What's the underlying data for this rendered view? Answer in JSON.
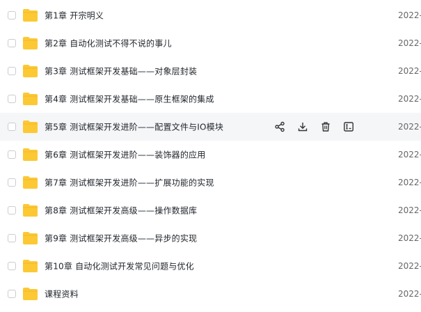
{
  "files": [
    {
      "name": "第1章 开宗明义",
      "date": "2022-"
    },
    {
      "name": "第2章 自动化测试不得不说的事儿",
      "date": "2022-"
    },
    {
      "name": "第3章 测试框架开发基础——对象层封装",
      "date": "2022-"
    },
    {
      "name": "第4章 测试框架开发基础——原生框架的集成",
      "date": "2022-"
    },
    {
      "name": "第5章 测试框架开发进阶——配置文件与IO模块",
      "date": "2022-"
    },
    {
      "name": "第6章 测试框架开发进阶——装饰器的应用",
      "date": "2022-"
    },
    {
      "name": "第7章 测试框架开发进阶——扩展功能的实现",
      "date": "2022-"
    },
    {
      "name": "第8章 测试框架开发高级——操作数据库",
      "date": "2022-"
    },
    {
      "name": "第9章 测试框架开发高级——异步的实现",
      "date": "2022-"
    },
    {
      "name": "第10章 自动化测试开发常见问题与优化",
      "date": "2022-"
    },
    {
      "name": "课程资料",
      "date": "2022-"
    }
  ],
  "hover_row_actions": [
    "share-icon",
    "download-icon",
    "delete-icon",
    "rename-icon"
  ],
  "colors": {
    "folder": "#fcc934",
    "folder_tab": "#f5b82e",
    "hover_bg": "#f5f6f8",
    "icon": "#333333"
  }
}
